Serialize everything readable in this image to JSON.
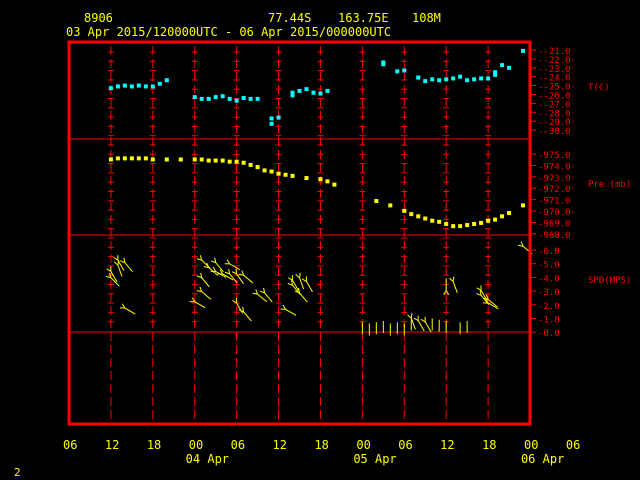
{
  "header": {
    "station": "8906",
    "lat": "77.44S",
    "lon": "163.75E",
    "elev": "108M",
    "period": "03 Apr 2015/120000UTC - 06 Apr 2015/000000UTC"
  },
  "page_number": "2",
  "colors": {
    "frame": "#ff0000",
    "text": "#ffff00",
    "temp": "#00ffff",
    "pressure": "#ffff00",
    "wind": "#ffff00",
    "grid": "#ff0000"
  },
  "chart_data": {
    "type": "scatter",
    "x_hours_since_03Apr_00UTC": [
      6,
      72
    ],
    "x_tick_labels": [
      "06",
      "12",
      "18",
      "00",
      "06",
      "12",
      "18",
      "00",
      "06",
      "12",
      "18",
      "00",
      "06"
    ],
    "day_labels": [
      "04 Apr",
      "05 Apr",
      "06 Apr"
    ],
    "panels": [
      {
        "name": "temperature",
        "axis_label": "T(C)",
        "ticks": [
          "-21.0",
          "-22.0",
          "-23.0",
          "-24.0",
          "-25.0",
          "-26.0",
          "-27.0",
          "-28.0",
          "-29.0",
          "-30.0"
        ],
        "ylim": [
          -30,
          -21
        ],
        "color": "#00ffff",
        "points": [
          [
            12,
            -25.3
          ],
          [
            13,
            -25.1
          ],
          [
            14,
            -25.0
          ],
          [
            15,
            -25.1
          ],
          [
            16,
            -25.0
          ],
          [
            17,
            -25.1
          ],
          [
            18,
            -25.1
          ],
          [
            19,
            -24.8
          ],
          [
            20,
            -24.4
          ],
          [
            24,
            -26.3
          ],
          [
            25,
            -26.5
          ],
          [
            26,
            -26.5
          ],
          [
            27,
            -26.3
          ],
          [
            28,
            -26.2
          ],
          [
            29,
            -26.5
          ],
          [
            30,
            -26.7
          ],
          [
            31,
            -26.4
          ],
          [
            32,
            -26.5
          ],
          [
            33,
            -26.5
          ],
          [
            35,
            -28.7
          ],
          [
            35,
            -29.3
          ],
          [
            36,
            -28.6
          ],
          [
            38,
            -26.1
          ],
          [
            38,
            -25.8
          ],
          [
            39,
            -25.6
          ],
          [
            40,
            -25.4
          ],
          [
            41,
            -25.8
          ],
          [
            42,
            -25.9
          ],
          [
            43,
            -25.6
          ],
          [
            51,
            -22.4
          ],
          [
            51,
            -22.6
          ],
          [
            53,
            -23.4
          ],
          [
            54,
            -23.3
          ],
          [
            56,
            -24.1
          ],
          [
            57,
            -24.5
          ],
          [
            58,
            -24.3
          ],
          [
            59,
            -24.4
          ],
          [
            60,
            -24.3
          ],
          [
            61,
            -24.2
          ],
          [
            62,
            -24.0
          ],
          [
            63,
            -24.4
          ],
          [
            64,
            -24.3
          ],
          [
            65,
            -24.2
          ],
          [
            66,
            -24.2
          ],
          [
            67,
            -23.8
          ],
          [
            67,
            -23.5
          ],
          [
            68,
            -22.7
          ],
          [
            69,
            -23.0
          ],
          [
            71,
            -21.1
          ]
        ]
      },
      {
        "name": "pressure",
        "axis_label": "Pre (mb)",
        "ticks": [
          "975.0",
          "974.0",
          "973.0",
          "972.0",
          "971.0",
          "970.0",
          "969.0",
          "968.0"
        ],
        "ylim": [
          968,
          975.5
        ],
        "color": "#ffff00",
        "points": [
          [
            12,
            975.0
          ],
          [
            13,
            975.1
          ],
          [
            14,
            975.1
          ],
          [
            15,
            975.1
          ],
          [
            16,
            975.1
          ],
          [
            17,
            975.1
          ],
          [
            18,
            975.0
          ],
          [
            20,
            975.0
          ],
          [
            22,
            975.0
          ],
          [
            24,
            975.0
          ],
          [
            25,
            975.0
          ],
          [
            26,
            974.9
          ],
          [
            27,
            974.9
          ],
          [
            28,
            974.9
          ],
          [
            29,
            974.8
          ],
          [
            30,
            974.8
          ],
          [
            31,
            974.7
          ],
          [
            32,
            974.5
          ],
          [
            33,
            974.3
          ],
          [
            34,
            974.0
          ],
          [
            35,
            973.9
          ],
          [
            36,
            973.7
          ],
          [
            37,
            973.6
          ],
          [
            38,
            973.5
          ],
          [
            40,
            973.3
          ],
          [
            42,
            973.2
          ],
          [
            43,
            973.0
          ],
          [
            44,
            972.7
          ],
          [
            50,
            971.2
          ],
          [
            52,
            970.8
          ],
          [
            54,
            970.3
          ],
          [
            55,
            970.0
          ],
          [
            56,
            969.8
          ],
          [
            57,
            969.6
          ],
          [
            58,
            969.4
          ],
          [
            59,
            969.3
          ],
          [
            60,
            969.1
          ],
          [
            61,
            968.9
          ],
          [
            62,
            968.9
          ],
          [
            63,
            969.0
          ],
          [
            64,
            969.1
          ],
          [
            65,
            969.2
          ],
          [
            66,
            969.4
          ],
          [
            67,
            969.5
          ],
          [
            68,
            969.8
          ],
          [
            69,
            970.1
          ],
          [
            71,
            970.8
          ]
        ]
      },
      {
        "name": "wind",
        "axis_label": "SPD(MPS)",
        "ticks": [
          "6.0",
          "5.0",
          "4.0",
          "3.0",
          "2.0",
          "1.0",
          "0.0"
        ],
        "ylim": [
          0,
          6.5
        ],
        "color": "#ffff00",
        "points": [
          [
            12,
            4.3,
            315
          ],
          [
            12,
            4.8,
            330
          ],
          [
            13,
            5.3,
            340
          ],
          [
            13,
            5.7,
            330
          ],
          [
            14,
            5.5,
            320
          ],
          [
            14,
            1.9,
            300
          ],
          [
            24,
            2.4,
            300
          ],
          [
            25,
            4.3,
            320
          ],
          [
            25,
            3.2,
            310
          ],
          [
            25,
            5.7,
            315
          ],
          [
            26,
            5.1,
            310
          ],
          [
            27,
            5.5,
            320
          ],
          [
            27,
            4.8,
            300
          ],
          [
            28,
            4.6,
            300
          ],
          [
            29,
            5.4,
            300
          ],
          [
            29,
            4.6,
            320
          ],
          [
            30,
            4.6,
            325
          ],
          [
            30,
            2.3,
            330
          ],
          [
            31,
            4.5,
            310
          ],
          [
            31,
            1.6,
            320
          ],
          [
            33,
            3.0,
            310
          ],
          [
            34,
            3.1,
            320
          ],
          [
            37,
            1.8,
            300
          ],
          [
            38,
            3.7,
            320
          ],
          [
            38,
            4.1,
            330
          ],
          [
            39,
            4.3,
            340
          ],
          [
            39,
            3.1,
            320
          ],
          [
            40,
            4.0,
            330
          ],
          [
            48,
            0.3,
            0
          ],
          [
            49,
            0.2,
            0
          ],
          [
            50,
            0.3,
            0
          ],
          [
            51,
            0.4,
            0
          ],
          [
            52,
            0.2,
            0
          ],
          [
            53,
            0.3,
            0
          ],
          [
            54,
            0.2,
            0
          ],
          [
            55,
            0.6,
            350
          ],
          [
            55,
            1.1,
            340
          ],
          [
            56,
            0.9,
            330
          ],
          [
            57,
            0.8,
            330
          ],
          [
            58,
            0.6,
            320
          ],
          [
            59,
            0.5,
            340
          ],
          [
            60,
            0.4,
            0
          ],
          [
            60,
            3.3,
            180
          ],
          [
            61,
            4.0,
            340
          ],
          [
            62,
            0.3,
            0
          ],
          [
            63,
            0.4,
            0
          ],
          [
            65,
            3.3,
            330
          ],
          [
            65,
            2.9,
            320
          ],
          [
            66,
            2.6,
            310
          ],
          [
            66,
            2.3,
            300
          ],
          [
            71,
            6.8,
            310
          ]
        ]
      }
    ]
  }
}
